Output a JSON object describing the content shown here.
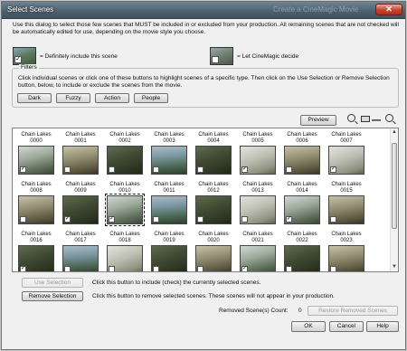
{
  "window": {
    "title": "Select Scenes",
    "background_title": "Create a CineMagic Movie",
    "close_label": "✕"
  },
  "intro_text": "Use this dialog to select those few scenes that MUST be included in or excluded from your production. All remaining scenes that are not checked will be automatically edited for use, depending on the movie style you choose.",
  "legend": {
    "include_label": "= Definitely include this scene",
    "cinemagic_label": "= Let CineMagic decide",
    "include_check": "✓"
  },
  "filters": {
    "title": "Filters",
    "description": "Click individual scenes or click one of these buttons to highlight scenes of a specific type. Then click on the Use Selection or Remove Selection button, below, to include or exclude the scenes from the movie.",
    "buttons": [
      "Dark",
      "Fuzzy",
      "Action",
      "People"
    ]
  },
  "preview_label": "Preview",
  "scenes": [
    {
      "name": "Chain Lakes",
      "num": "0000",
      "style": "t-snow",
      "checked": true,
      "selected": false
    },
    {
      "name": "Chain Lakes",
      "num": "0001",
      "style": "t-trail",
      "checked": false,
      "selected": false
    },
    {
      "name": "Chain Lakes",
      "num": "0002",
      "style": "t-forest",
      "checked": false,
      "selected": false
    },
    {
      "name": "Chain Lakes",
      "num": "0003",
      "style": "t-lake",
      "checked": false,
      "selected": false
    },
    {
      "name": "Chain Lakes",
      "num": "0004",
      "style": "t-forest",
      "checked": false,
      "selected": false
    },
    {
      "name": "Chain Lakes",
      "num": "0005",
      "style": "t-bright",
      "checked": true,
      "selected": false
    },
    {
      "name": "Chain Lakes",
      "num": "0006",
      "style": "t-trail",
      "checked": false,
      "selected": false
    },
    {
      "name": "Chain Lakes",
      "num": "0007",
      "style": "t-bright",
      "checked": true,
      "selected": false
    },
    {
      "name": "Chain Lakes",
      "num": "0008",
      "style": "t-trail",
      "checked": false,
      "selected": false
    },
    {
      "name": "Chain Lakes",
      "num": "0009",
      "style": "t-forest",
      "checked": true,
      "selected": false
    },
    {
      "name": "Chain Lakes",
      "num": "0010",
      "style": "t-snow",
      "checked": true,
      "selected": true
    },
    {
      "name": "Chain Lakes",
      "num": "0011",
      "style": "t-lake",
      "checked": false,
      "selected": false
    },
    {
      "name": "Chain Lakes",
      "num": "0012",
      "style": "t-forest",
      "checked": false,
      "selected": false
    },
    {
      "name": "Chain Lakes",
      "num": "0013",
      "style": "t-bright",
      "checked": false,
      "selected": false
    },
    {
      "name": "Chain Lakes",
      "num": "0014",
      "style": "t-snow",
      "checked": true,
      "selected": false
    },
    {
      "name": "Chain Lakes",
      "num": "0015",
      "style": "t-trail",
      "checked": false,
      "selected": false
    },
    {
      "name": "Chain Lakes",
      "num": "0016",
      "style": "t-forest",
      "checked": true,
      "selected": false
    },
    {
      "name": "Chain Lakes",
      "num": "0017",
      "style": "t-lake",
      "checked": false,
      "selected": false
    },
    {
      "name": "Chain Lakes",
      "num": "0018",
      "style": "t-bright",
      "checked": false,
      "selected": false
    },
    {
      "name": "Chain Lakes",
      "num": "0019",
      "style": "t-forest",
      "checked": false,
      "selected": false
    },
    {
      "name": "Chain Lakes",
      "num": "0020",
      "style": "t-trail",
      "checked": false,
      "selected": false
    },
    {
      "name": "Chain Lakes",
      "num": "0021",
      "style": "t-snow",
      "checked": true,
      "selected": false
    },
    {
      "name": "Chain Lakes",
      "num": "0022",
      "style": "t-forest",
      "checked": false,
      "selected": false
    },
    {
      "name": "Chain Lakes",
      "num": "0023",
      "style": "t-trail",
      "checked": false,
      "selected": false
    },
    {
      "name": "",
      "num": "",
      "style": "t-dark",
      "checked": false,
      "selected": false
    },
    {
      "name": "",
      "num": "",
      "style": "t-dark",
      "checked": false,
      "selected": false
    },
    {
      "name": "",
      "num": "",
      "style": "t-night",
      "checked": false,
      "selected": false
    },
    {
      "name": "",
      "num": "",
      "style": "t-dark",
      "checked": false,
      "selected": false
    },
    {
      "name": "",
      "num": "",
      "style": "t-fire",
      "checked": false,
      "selected": false
    },
    {
      "name": "",
      "num": "",
      "style": "t-fire",
      "checked": false,
      "selected": false
    },
    {
      "name": "",
      "num": "",
      "style": "t-fire",
      "checked": false,
      "selected": false
    },
    {
      "name": "",
      "num": "",
      "style": "t-fire",
      "checked": false,
      "selected": false
    }
  ],
  "use_selection": {
    "label": "Use Selection",
    "help": "Click this button to include (check) the currently selected scenes."
  },
  "remove_selection": {
    "label": "Remove Selection",
    "help": "Click this button to remove selected scenes. These scenes will not appear in your production."
  },
  "removed_count": {
    "label": "Removed Scene(s) Count:",
    "value": "0"
  },
  "restore_label": "Restore Removed Scenes",
  "footer": {
    "ok": "OK",
    "cancel": "Cancel",
    "help": "Help"
  }
}
